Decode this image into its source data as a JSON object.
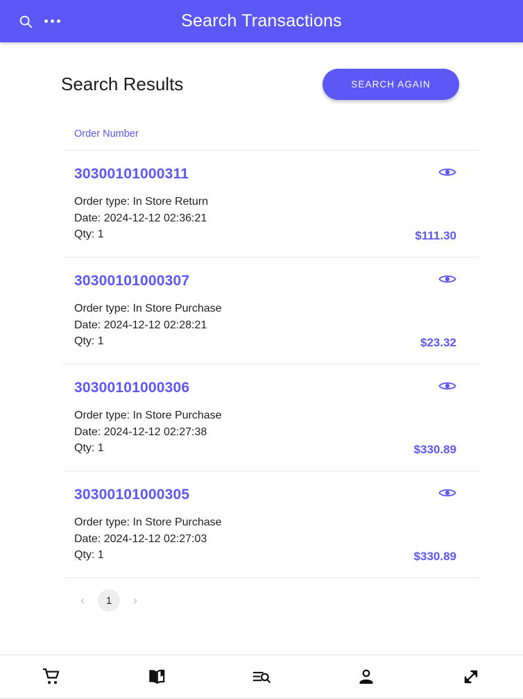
{
  "appbar": {
    "title": "Search Transactions",
    "search_icon": "search-icon",
    "overflow_icon": "more-options-icon"
  },
  "results": {
    "title": "Search Results",
    "search_again_label": "SEARCH AGAIN",
    "column_header": "Order Number",
    "transactions": [
      {
        "order_number": "30300101000311",
        "order_type": "Order type: In Store Return",
        "date": "Date: 2024-12-12 02:36:21",
        "qty": "Qty: 1",
        "amount": "$111.30",
        "view_icon": "eye-icon"
      },
      {
        "order_number": "30300101000307",
        "order_type": "Order type: In Store Purchase",
        "date": "Date: 2024-12-12 02:28:21",
        "qty": "Qty: 1",
        "amount": "$23.32",
        "view_icon": "eye-icon"
      },
      {
        "order_number": "30300101000306",
        "order_type": "Order type: In Store Purchase",
        "date": "Date: 2024-12-12 02:27:38",
        "qty": "Qty: 1",
        "amount": "$330.89",
        "view_icon": "eye-icon"
      },
      {
        "order_number": "30300101000305",
        "order_type": "Order type: In Store Purchase",
        "date": "Date: 2024-12-12 02:27:03",
        "qty": "Qty: 1",
        "amount": "$330.89",
        "view_icon": "eye-icon"
      }
    ]
  },
  "pagination": {
    "prev_label": "‹",
    "next_label": "›",
    "current_page": "1"
  },
  "bottom_nav": {
    "items": [
      {
        "name": "cart",
        "icon": "shopping-cart-icon"
      },
      {
        "name": "catalog",
        "icon": "open-book-icon"
      },
      {
        "name": "search-list",
        "icon": "list-search-icon"
      },
      {
        "name": "account",
        "icon": "person-icon"
      },
      {
        "name": "expand",
        "icon": "expand-arrows-icon"
      }
    ]
  },
  "theme": {
    "accent": "#5b58f5",
    "appbar_bg": "#5b58f5",
    "page_bg": "#ffffff",
    "amount_color": "#5b58f5"
  }
}
